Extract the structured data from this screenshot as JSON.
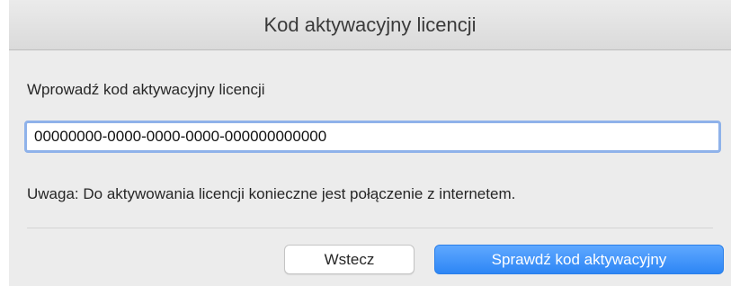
{
  "window": {
    "title": "Kod aktywacyjny licencji"
  },
  "form": {
    "prompt": "Wprowadź kod aktywacyjny licencji",
    "code_value": "00000000-0000-0000-0000-000000000000",
    "note": "Uwaga: Do aktywowania licencji konieczne jest połączenie z internetem."
  },
  "buttons": {
    "back_label": "Wstecz",
    "check_label": "Sprawdź kod aktywacyjny"
  },
  "colors": {
    "primary_button": "#2d86f5",
    "focus_ring": "#8fb2ea",
    "background": "#ececec"
  }
}
